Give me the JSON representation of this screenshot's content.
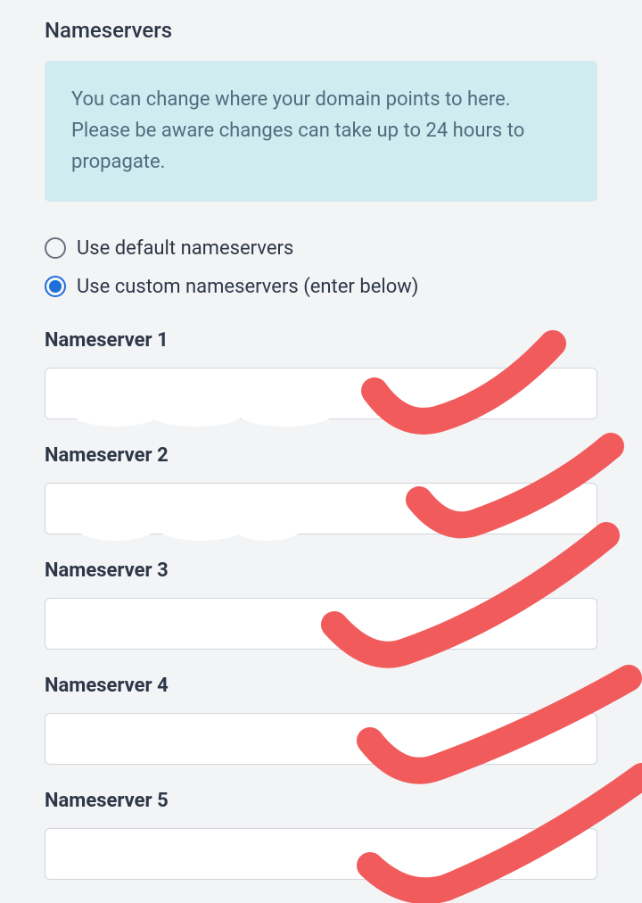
{
  "section": {
    "title": "Nameservers"
  },
  "info": {
    "text": "You can change where your domain points to here. Please be aware changes can take up to 24 hours to propagate."
  },
  "radios": {
    "default": {
      "label": "Use default nameservers",
      "selected": false
    },
    "custom": {
      "label": "Use custom nameservers (enter below)",
      "selected": true
    }
  },
  "fields": [
    {
      "label": "Nameserver 1",
      "value": ""
    },
    {
      "label": "Nameserver 2",
      "value": ""
    },
    {
      "label": "Nameserver 3",
      "value": ""
    },
    {
      "label": "Nameserver 4",
      "value": ""
    },
    {
      "label": "Nameserver 5",
      "value": ""
    }
  ]
}
